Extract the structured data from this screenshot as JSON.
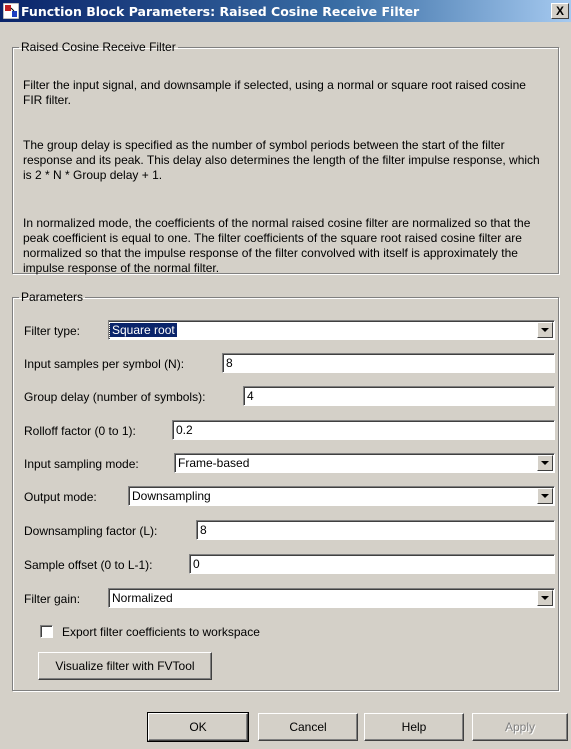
{
  "window": {
    "title": "Function Block Parameters: Raised Cosine Receive Filter",
    "close_label": "X"
  },
  "description_group": {
    "legend": "Raised Cosine Receive Filter",
    "paragraphs": [
      "Filter the input signal, and downsample if selected, using a normal or square root raised cosine FIR filter.",
      "The group delay is specified as the number of symbol periods between the start of the filter response and its peak. This delay also determines the length of the filter impulse response, which is 2 * N * Group delay + 1.",
      "In normalized mode, the coefficients of the normal raised cosine filter are normalized so that the peak coefficient is equal to one. The filter coefficients of the square root raised cosine filter are normalized so that the impulse response of the filter convolved with itself is approximately the impulse response of the normal filter."
    ]
  },
  "parameters_group": {
    "legend": "Parameters",
    "filter_type": {
      "label": "Filter type:",
      "value": "Square root"
    },
    "input_samples_per_symbol": {
      "label": "Input samples per symbol (N):",
      "value": "8"
    },
    "group_delay": {
      "label": "Group delay (number of symbols):",
      "value": "4"
    },
    "rolloff_factor": {
      "label": "Rolloff factor (0 to 1):",
      "value": "0.2"
    },
    "input_sampling_mode": {
      "label": "Input sampling mode:",
      "value": "Frame-based"
    },
    "output_mode": {
      "label": "Output mode:",
      "value": "Downsampling"
    },
    "downsampling_factor": {
      "label": "Downsampling factor (L):",
      "value": "8"
    },
    "sample_offset": {
      "label": "Sample offset (0 to L-1):",
      "value": "0"
    },
    "filter_gain": {
      "label": "Filter gain:",
      "value": "Normalized"
    },
    "export_checkbox": {
      "label": "Export filter coefficients to workspace",
      "checked": false
    },
    "visualize_button": "Visualize filter with FVTool"
  },
  "buttons": {
    "ok": "OK",
    "cancel": "Cancel",
    "help": "Help",
    "apply": "Apply"
  },
  "colors": {
    "dialog_bg": "#d4d0c8",
    "title_gradient_start": "#0a246a",
    "selection": "#0a246a"
  }
}
